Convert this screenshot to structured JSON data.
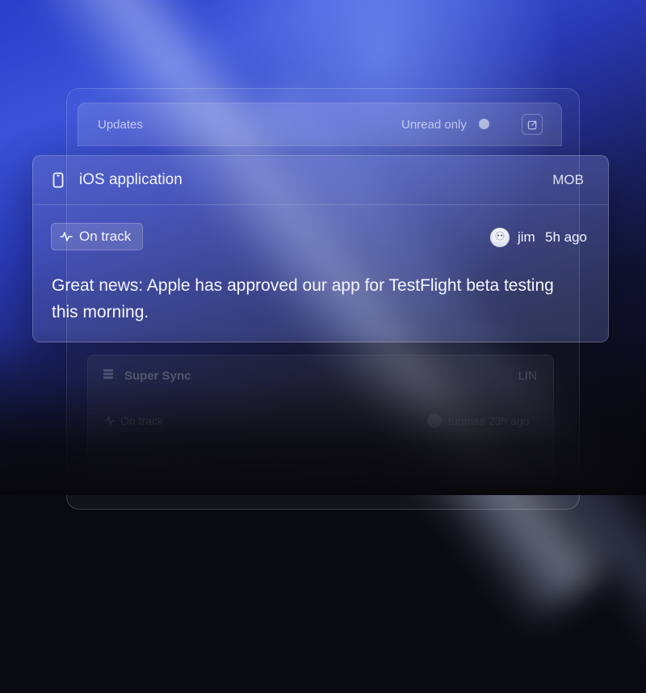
{
  "updates_panel": {
    "title": "Updates",
    "unread_toggle_label": "Unread only",
    "unread_only": false,
    "compose_icon": "compose-icon"
  },
  "update_card": {
    "project_icon": "phone-icon",
    "project_name": "iOS application",
    "project_code": "MOB",
    "status_icon": "pulse-icon",
    "status": "On track",
    "author": "jim",
    "time_ago": "5h ago",
    "message": "Great news: Apple has approved our app for TestFlight beta testing this morning."
  },
  "next_card": {
    "project_icon": "stack-icon",
    "project_name": "Super Sync",
    "project_code": "LIN",
    "status": "On track",
    "author": "tuomas",
    "time_ago": "23h ago"
  },
  "colors": {
    "accent_blue": "#3a52d8",
    "text_primary": "#f2f4ff"
  }
}
